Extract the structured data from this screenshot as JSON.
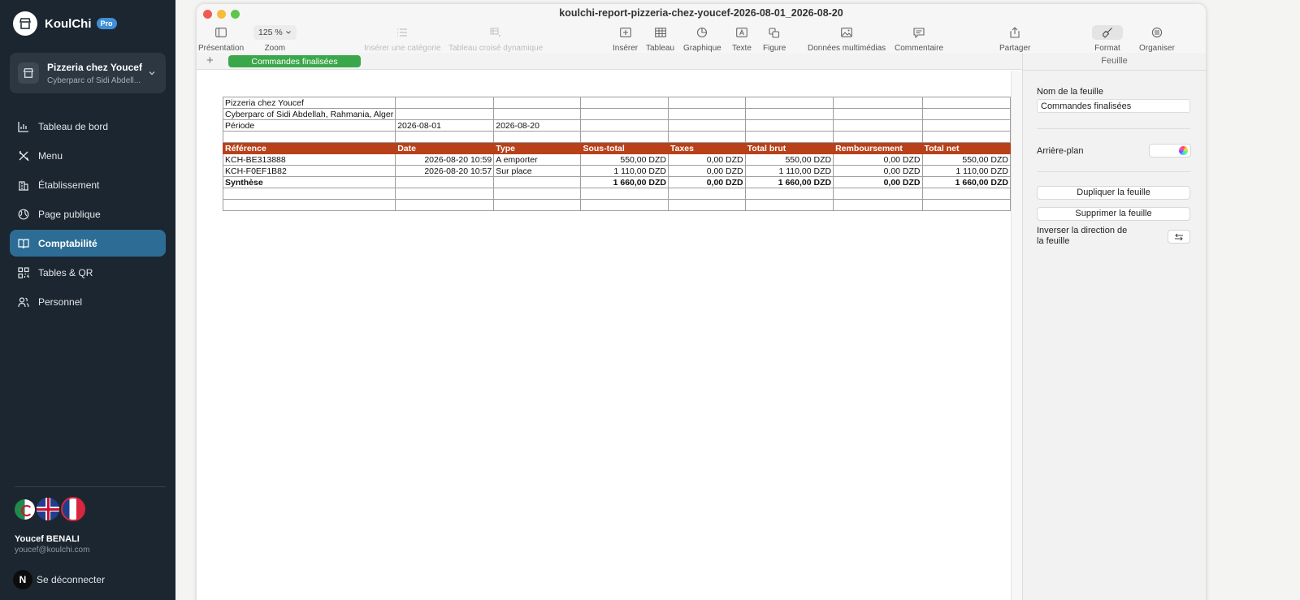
{
  "sidebar": {
    "brand": {
      "name": "KoulChi",
      "badge": "Pro"
    },
    "venue": {
      "name": "Pizzeria chez Youcef",
      "address": "Cyberparc of Sidi Abdell..."
    },
    "nav": [
      {
        "label": "Tableau de bord",
        "icon": "bar-chart-icon"
      },
      {
        "label": "Menu",
        "icon": "utensils-icon"
      },
      {
        "label": "Établissement",
        "icon": "building-icon"
      },
      {
        "label": "Page publique",
        "icon": "globe-icon"
      },
      {
        "label": "Comptabilité",
        "icon": "book-icon",
        "active": true
      },
      {
        "label": "Tables & QR",
        "icon": "qr-code-icon"
      },
      {
        "label": "Personnel",
        "icon": "users-icon"
      }
    ],
    "user": {
      "name": "Youcef BENALI",
      "email": "youcef@koulchi.com"
    },
    "logout_label": "Se déconnecter",
    "avatar_letter": "N"
  },
  "window": {
    "title": "koulchi-report-pizzeria-chez-youcef-2026-08-01_2026-08-20",
    "toolbar": {
      "presentation": "Présentation",
      "zoom_value": "125 %",
      "zoom": "Zoom",
      "insert_category": "Insérer une catégorie",
      "pivot_table": "Tableau croisé dynamique",
      "insert": "Insérer",
      "table": "Tableau",
      "chart": "Graphique",
      "text": "Texte",
      "shape": "Figure",
      "media": "Données multimédias",
      "comment": "Commentaire",
      "share": "Partager",
      "format": "Format",
      "organize": "Organiser"
    },
    "sheet_tab": "Commandes finalisées",
    "add_sheet": "+"
  },
  "sheet": {
    "info_rows": [
      [
        "Pizzeria chez Youcef",
        "",
        "",
        "",
        "",
        "",
        "",
        ""
      ],
      [
        "Cyberparc of Sidi Abdellah, Rahmania, Alger",
        "",
        "",
        "",
        "",
        "",
        "",
        ""
      ],
      [
        "Période",
        "2026-08-01",
        "2026-08-20",
        "",
        "",
        "",
        "",
        ""
      ],
      [
        "",
        "",
        "",
        "",
        "",
        "",
        "",
        ""
      ]
    ],
    "headers": [
      "Référence",
      "Date",
      "Type",
      "Sous-total",
      "Taxes",
      "Total brut",
      "Remboursement",
      "Total net"
    ],
    "rows": [
      [
        "KCH-BE313888",
        "2026-08-20 10:59",
        "A emporter",
        "550,00 DZD",
        "0,00 DZD",
        "550,00 DZD",
        "0,00 DZD",
        "550,00 DZD"
      ],
      [
        "KCH-F0EF1B82",
        "2026-08-20 10:57",
        "Sur place",
        "1 110,00 DZD",
        "0,00 DZD",
        "1 110,00 DZD",
        "0,00 DZD",
        "1 110,00 DZD"
      ]
    ],
    "summary": [
      "Synthèse",
      "",
      "",
      "1 660,00 DZD",
      "0,00 DZD",
      "1 660,00 DZD",
      "0,00 DZD",
      "1 660,00 DZD"
    ],
    "empty_rows": 2
  },
  "inspector": {
    "tab_title": "Feuille",
    "sheet_name_label": "Nom de la feuille",
    "sheet_name_value": "Commandes finalisées",
    "background_label": "Arrière-plan",
    "duplicate_label": "Dupliquer la feuille",
    "delete_label": "Supprimer la feuille",
    "rtl_label_1": "Inverser la direction de",
    "rtl_label_2": "la feuille"
  }
}
